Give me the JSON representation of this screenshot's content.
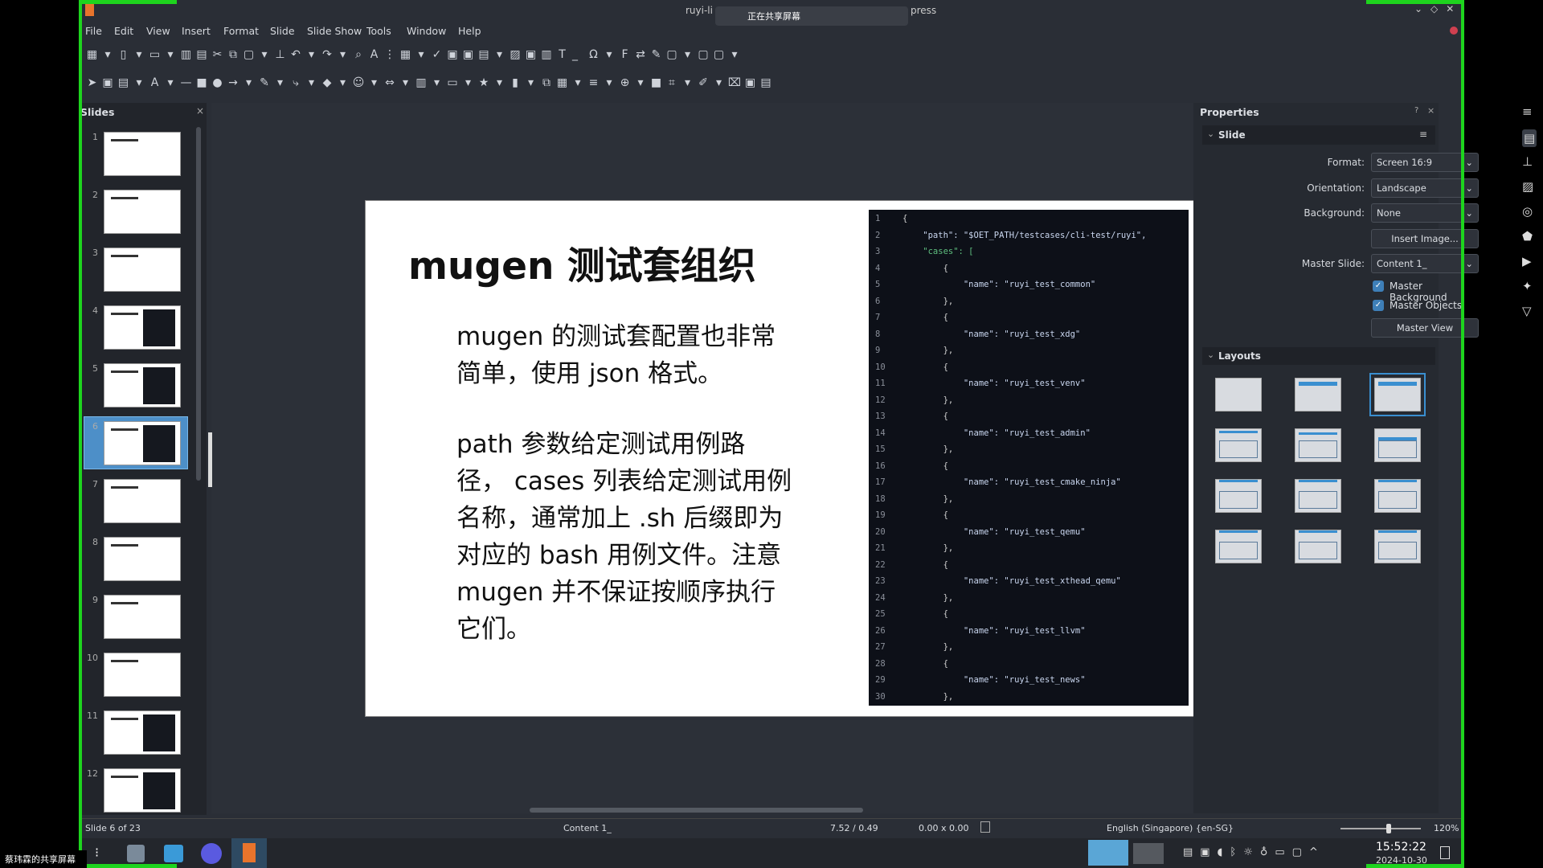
{
  "window": {
    "title_left": "ruyi-li",
    "title_right": "press",
    "share_overlay": "正在共享屏幕"
  },
  "menu": [
    "File",
    "Edit",
    "View",
    "Insert",
    "Format",
    "Slide",
    "Slide Show",
    "Tools",
    "Window",
    "Help"
  ],
  "slides_panel": {
    "title": "Slides",
    "close": "×",
    "count_visible": 12,
    "selected": 6
  },
  "slide": {
    "title": "mugen 测试套组织",
    "paragraph1": [
      "mugen 的测试套配置也非常",
      "简单，使用 json 格式。"
    ],
    "paragraph2": [
      "path 参数给定测试用例路",
      "径， cases 列表给定测试用例",
      "名称，通常加上 .sh 后缀即为",
      "对应的 bash 用例文件。注意",
      "mugen 并不保证按顺序执行",
      "它们。"
    ],
    "page_number": "6",
    "code_lines": [
      "{",
      "    \"path\": \"$OET_PATH/testcases/cli-test/ruyi\",",
      "    \"cases\": [",
      "        {",
      "            \"name\": \"ruyi_test_common\"",
      "        },",
      "        {",
      "            \"name\": \"ruyi_test_xdg\"",
      "        },",
      "        {",
      "            \"name\": \"ruyi_test_venv\"",
      "        },",
      "        {",
      "            \"name\": \"ruyi_test_admin\"",
      "        },",
      "        {",
      "            \"name\": \"ruyi_test_cmake_ninja\"",
      "        },",
      "        {",
      "            \"name\": \"ruyi_test_qemu\"",
      "        },",
      "        {",
      "            \"name\": \"ruyi_test_xthead_qemu\"",
      "        },",
      "        {",
      "            \"name\": \"ruyi_test_llvm\"",
      "        },",
      "        {",
      "            \"name\": \"ruyi_test_news\"",
      "        },"
    ]
  },
  "properties": {
    "title": "Properties",
    "help": "?",
    "close": "×",
    "section_slide": "Slide",
    "format_label": "Format:",
    "format_value": "Screen 16:9",
    "orientation_label": "Orientation:",
    "orientation_value": "Landscape",
    "background_label": "Background:",
    "background_value": "None",
    "insert_image": "Insert Image...",
    "master_slide_label": "Master Slide:",
    "master_slide_value": "Content 1_",
    "master_background": "Master Background",
    "master_background_checked": true,
    "master_objects": "Master Objects",
    "master_objects_checked": true,
    "master_view": "Master View",
    "section_layouts": "Layouts",
    "selected_layout": 3
  },
  "status": {
    "slide": "Slide 6 of 23",
    "master": "Content 1_",
    "position": "7.52 / 0.49",
    "size": "0.00 x 0.00",
    "language": "English (Singapore) {en-SG}",
    "zoom": "120%",
    "zoom_level": 0.6
  },
  "taskbar": {
    "clock": "15:52:22",
    "date": "2024-10-30",
    "share_label": "蔡玮霖的共享屏幕"
  },
  "colors": {
    "accent": "#3a8fd0",
    "share_border": "#1ed41e"
  }
}
